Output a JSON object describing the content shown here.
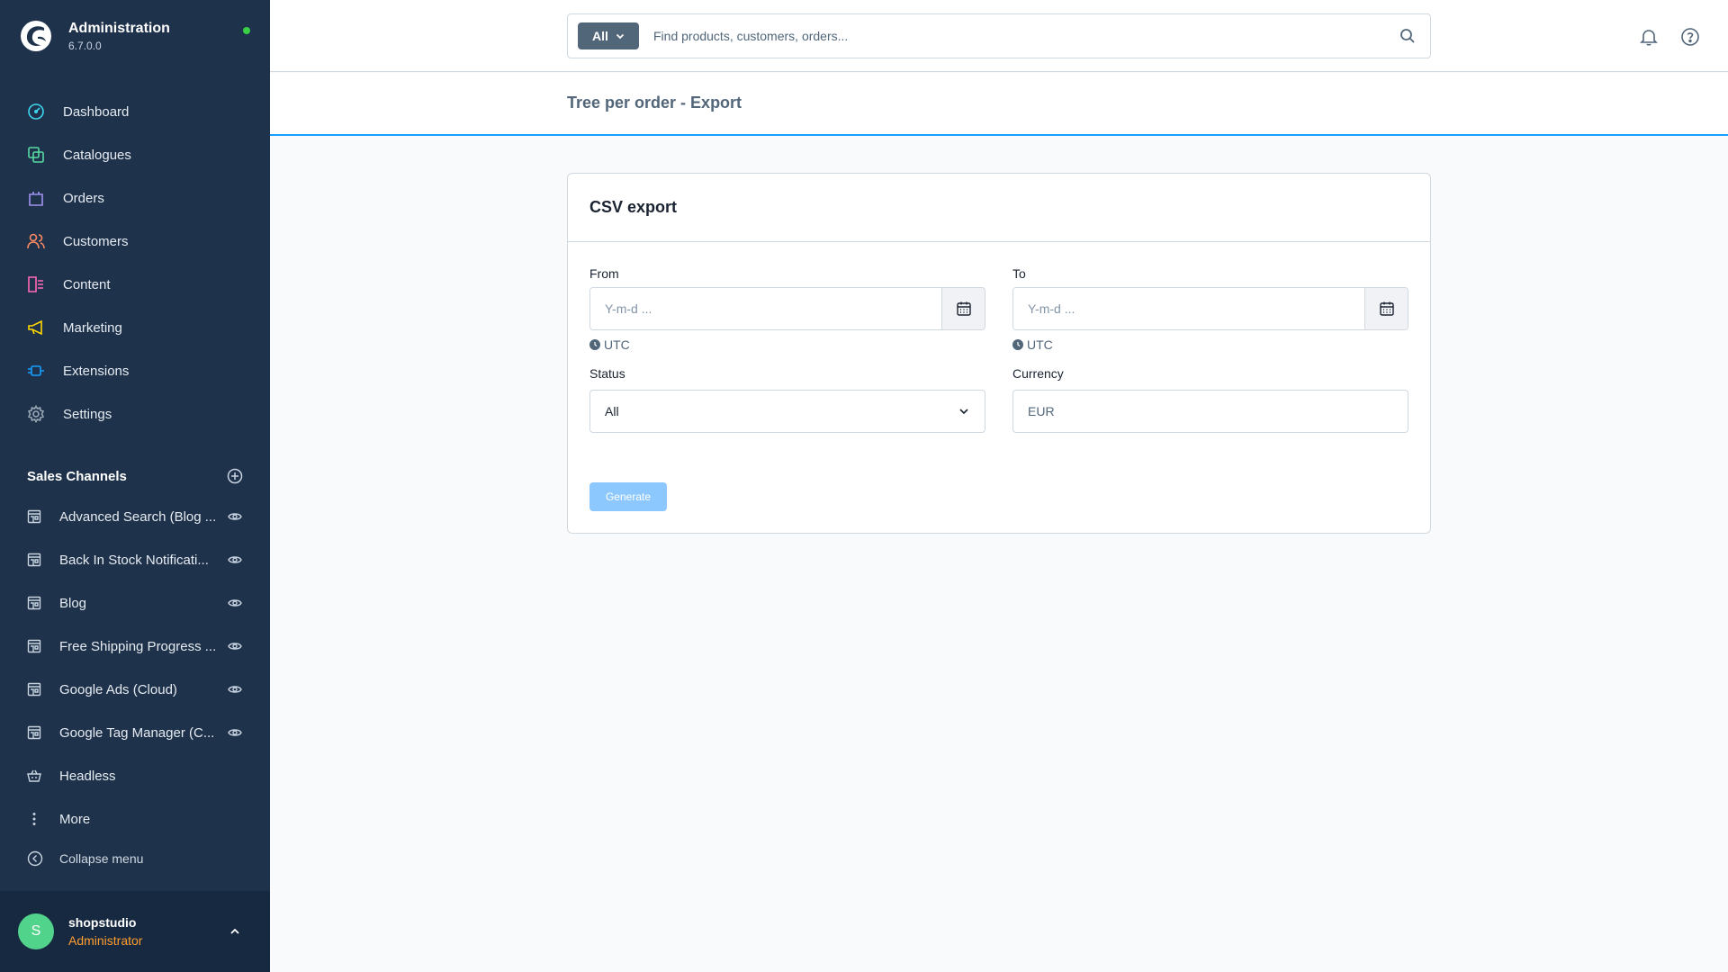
{
  "app": {
    "title": "Administration",
    "version": "6.7.0.0",
    "status_color": "#37d046",
    "logo_icon": "shopware-logo"
  },
  "nav": {
    "items": [
      {
        "label": "Dashboard",
        "icon": "gauge-icon",
        "color": "#3ed6ef"
      },
      {
        "label": "Catalogues",
        "icon": "catalogues-icon",
        "color": "#57d9a3"
      },
      {
        "label": "Orders",
        "icon": "bag-icon",
        "color": "#a092f0"
      },
      {
        "label": "Customers",
        "icon": "users-icon",
        "color": "#f88962"
      },
      {
        "label": "Content",
        "icon": "content-icon",
        "color": "#ff68b4"
      },
      {
        "label": "Marketing",
        "icon": "megaphone-icon",
        "color": "#ffd700"
      },
      {
        "label": "Extensions",
        "icon": "plug-icon",
        "color": "#189eff"
      },
      {
        "label": "Settings",
        "icon": "gear-icon",
        "color": "#9aa8b5"
      }
    ]
  },
  "sales_channels": {
    "title": "Sales Channels",
    "items": [
      {
        "label": "Advanced Search (Blog ...",
        "icon": "storefront-icon"
      },
      {
        "label": "Back In Stock Notificati...",
        "icon": "storefront-icon"
      },
      {
        "label": "Blog",
        "icon": "storefront-icon"
      },
      {
        "label": "Free Shipping Progress ...",
        "icon": "storefront-icon"
      },
      {
        "label": "Google Ads (Cloud)",
        "icon": "storefront-icon"
      },
      {
        "label": "Google Tag Manager (C...",
        "icon": "storefront-icon"
      },
      {
        "label": "Headless",
        "icon": "basket-icon"
      },
      {
        "label": "More",
        "icon": "more-vertical-icon"
      }
    ],
    "collapse_label": "Collapse menu"
  },
  "user": {
    "initial": "S",
    "name": "shopstudio",
    "role": "Administrator",
    "avatar_color": "#52d38b"
  },
  "search": {
    "type_label": "All",
    "placeholder": "Find products, customers, orders..."
  },
  "page": {
    "title": "Tree per order - Export"
  },
  "card": {
    "title": "CSV export",
    "from_label": "From",
    "to_label": "To",
    "date_placeholder": "Y-m-d ...",
    "timezone": "UTC",
    "status_label": "Status",
    "status_value": "All",
    "currency_label": "Currency",
    "currency_value": "EUR",
    "generate_label": "Generate"
  },
  "colors": {
    "sidebar_bg": "#1f324b",
    "accent": "#189eff",
    "button_disabled": "#8cc8fe"
  }
}
